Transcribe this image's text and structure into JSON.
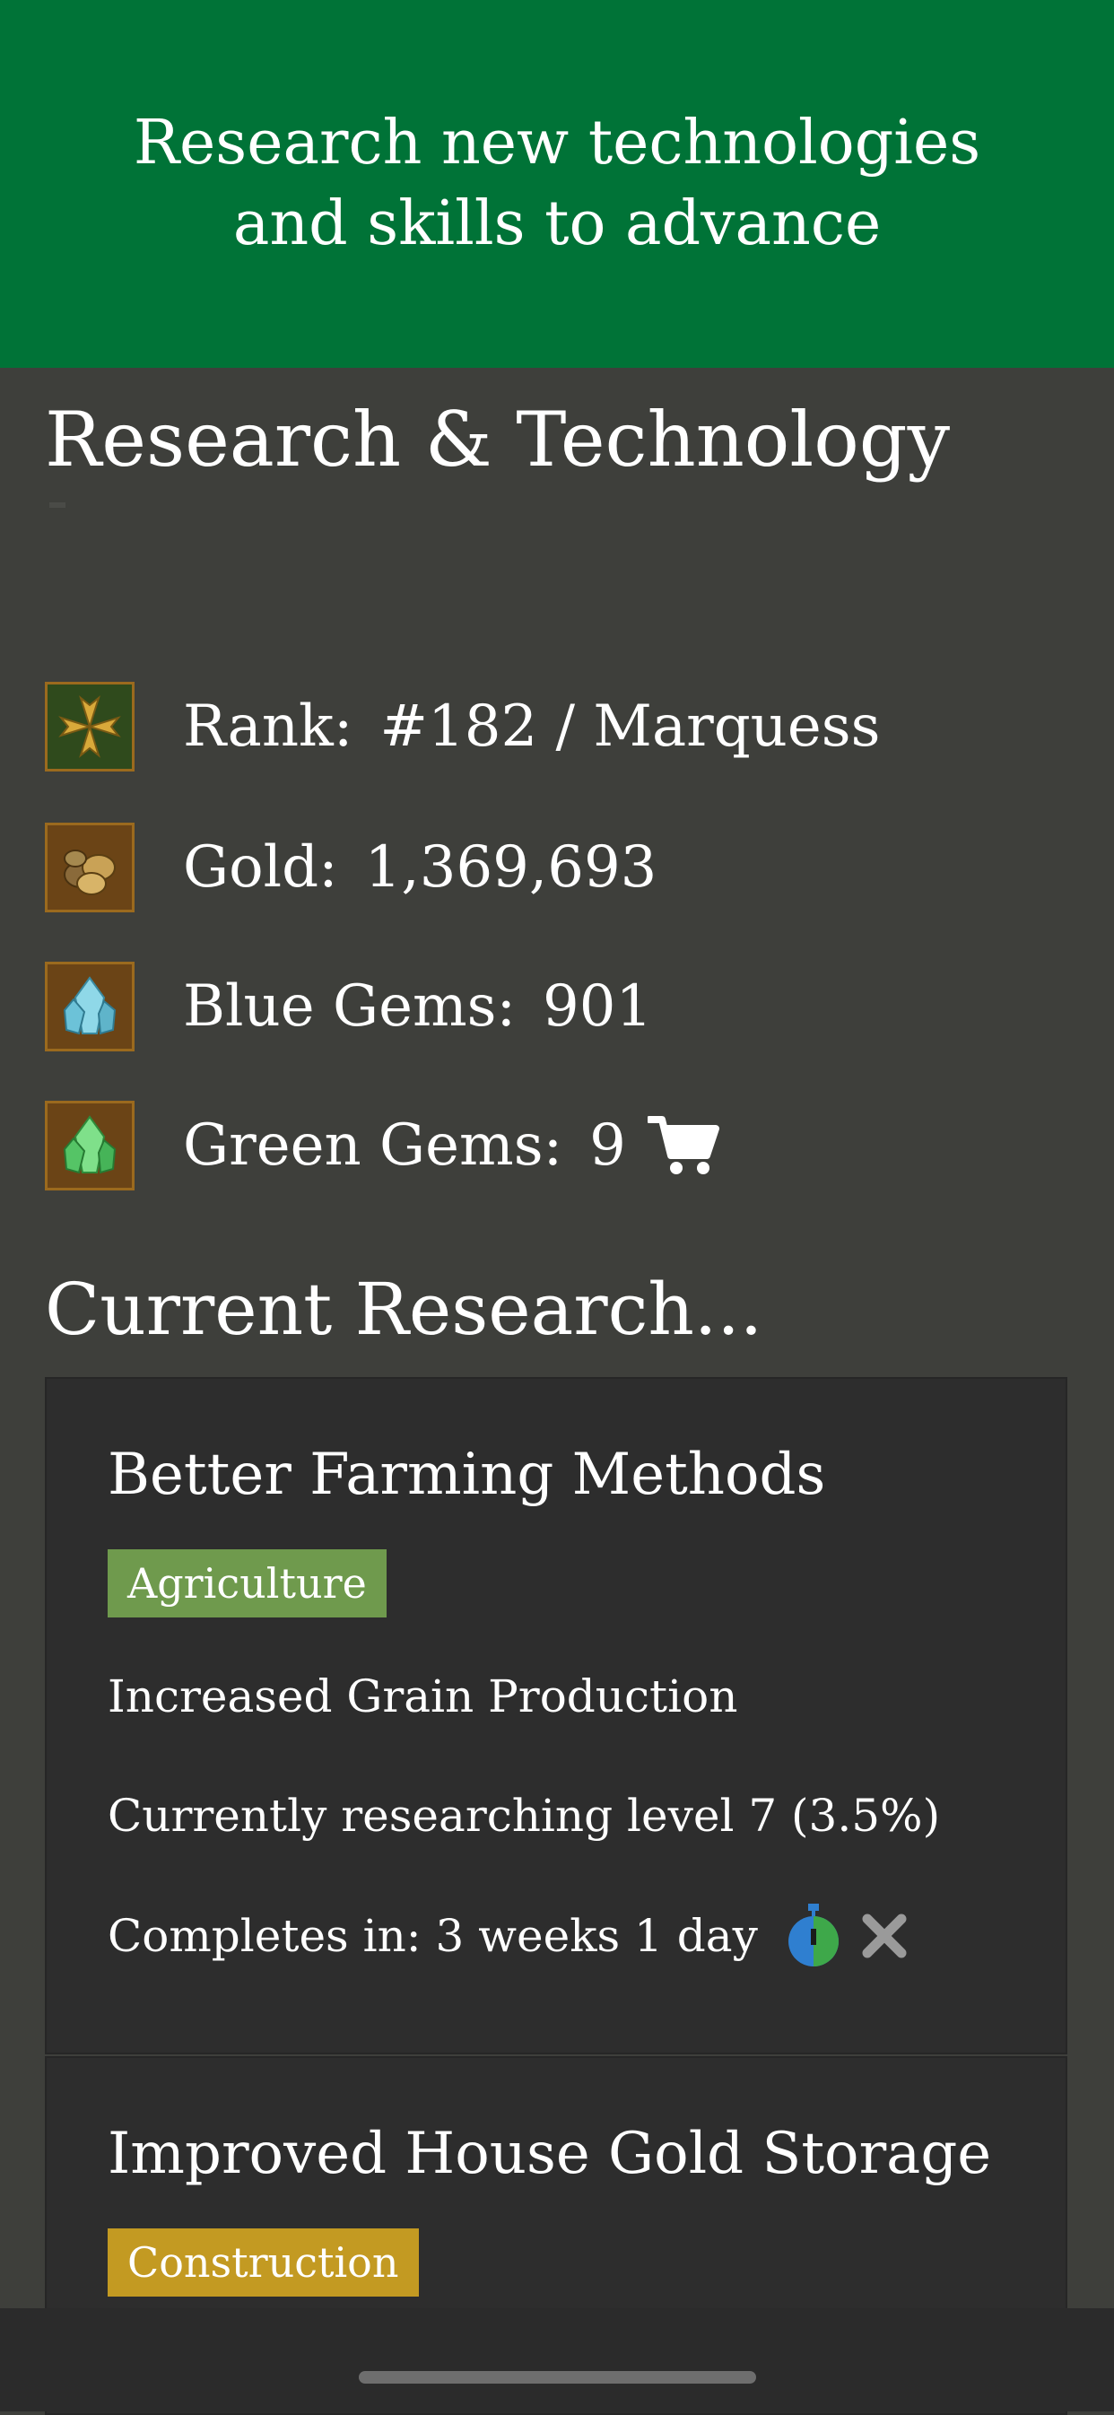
{
  "banner": {
    "text": "Research new technologies and skills to advance"
  },
  "page": {
    "title": "Research & Technology"
  },
  "stats": [
    {
      "label": "Rank:",
      "value": "#182 / Marquess",
      "icon": "maltese-cross-icon"
    },
    {
      "label": "Gold:",
      "value": "1,369,693",
      "icon": "gold-coins-icon"
    },
    {
      "label": "Blue Gems:",
      "value": "901",
      "icon": "blue-gem-icon"
    },
    {
      "label": "Green Gems:",
      "value": "9",
      "icon": "green-gem-icon",
      "action_icon": "shopping-cart-icon"
    }
  ],
  "current_research": {
    "heading": "Current Research...",
    "items": [
      {
        "title": "Better Farming Methods",
        "category": "Agriculture",
        "category_color": "#6f9a4d",
        "effect": "Increased Grain Production",
        "status": "Currently researching level 7 (3.5%)",
        "completes": "Completes in: 3 weeks 1 day",
        "icons": [
          "stopwatch-icon",
          "cancel-icon"
        ]
      },
      {
        "title": "Improved House Gold Storage",
        "category": "Construction",
        "category_color": "#c39a22"
      }
    ]
  },
  "colors": {
    "banner": "#007337",
    "background": "#3e3f3b",
    "card": "#2d2d2d",
    "text": "#ffffff"
  }
}
